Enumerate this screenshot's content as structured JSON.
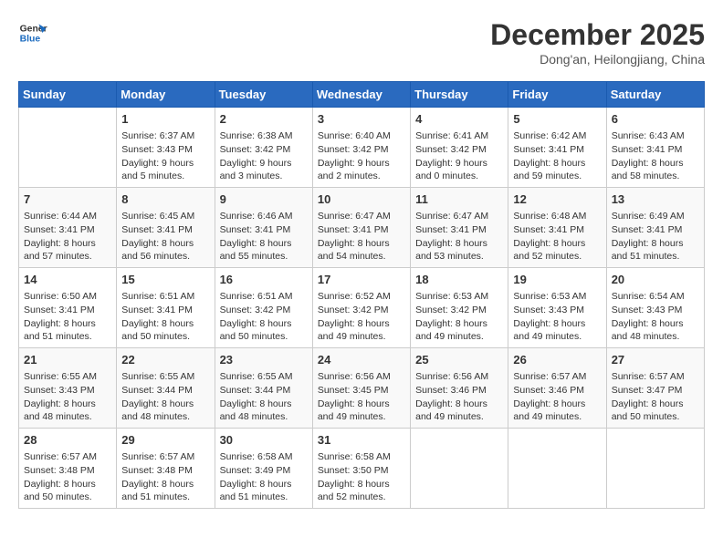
{
  "logo": {
    "line1": "General",
    "line2": "Blue"
  },
  "title": "December 2025",
  "subtitle": "Dong'an, Heilongjiang, China",
  "days_header": [
    "Sunday",
    "Monday",
    "Tuesday",
    "Wednesday",
    "Thursday",
    "Friday",
    "Saturday"
  ],
  "weeks": [
    [
      {
        "num": "",
        "info": ""
      },
      {
        "num": "1",
        "info": "Sunrise: 6:37 AM\nSunset: 3:43 PM\nDaylight: 9 hours\nand 5 minutes."
      },
      {
        "num": "2",
        "info": "Sunrise: 6:38 AM\nSunset: 3:42 PM\nDaylight: 9 hours\nand 3 minutes."
      },
      {
        "num": "3",
        "info": "Sunrise: 6:40 AM\nSunset: 3:42 PM\nDaylight: 9 hours\nand 2 minutes."
      },
      {
        "num": "4",
        "info": "Sunrise: 6:41 AM\nSunset: 3:42 PM\nDaylight: 9 hours\nand 0 minutes."
      },
      {
        "num": "5",
        "info": "Sunrise: 6:42 AM\nSunset: 3:41 PM\nDaylight: 8 hours\nand 59 minutes."
      },
      {
        "num": "6",
        "info": "Sunrise: 6:43 AM\nSunset: 3:41 PM\nDaylight: 8 hours\nand 58 minutes."
      }
    ],
    [
      {
        "num": "7",
        "info": "Sunrise: 6:44 AM\nSunset: 3:41 PM\nDaylight: 8 hours\nand 57 minutes."
      },
      {
        "num": "8",
        "info": "Sunrise: 6:45 AM\nSunset: 3:41 PM\nDaylight: 8 hours\nand 56 minutes."
      },
      {
        "num": "9",
        "info": "Sunrise: 6:46 AM\nSunset: 3:41 PM\nDaylight: 8 hours\nand 55 minutes."
      },
      {
        "num": "10",
        "info": "Sunrise: 6:47 AM\nSunset: 3:41 PM\nDaylight: 8 hours\nand 54 minutes."
      },
      {
        "num": "11",
        "info": "Sunrise: 6:47 AM\nSunset: 3:41 PM\nDaylight: 8 hours\nand 53 minutes."
      },
      {
        "num": "12",
        "info": "Sunrise: 6:48 AM\nSunset: 3:41 PM\nDaylight: 8 hours\nand 52 minutes."
      },
      {
        "num": "13",
        "info": "Sunrise: 6:49 AM\nSunset: 3:41 PM\nDaylight: 8 hours\nand 51 minutes."
      }
    ],
    [
      {
        "num": "14",
        "info": "Sunrise: 6:50 AM\nSunset: 3:41 PM\nDaylight: 8 hours\nand 51 minutes."
      },
      {
        "num": "15",
        "info": "Sunrise: 6:51 AM\nSunset: 3:41 PM\nDaylight: 8 hours\nand 50 minutes."
      },
      {
        "num": "16",
        "info": "Sunrise: 6:51 AM\nSunset: 3:42 PM\nDaylight: 8 hours\nand 50 minutes."
      },
      {
        "num": "17",
        "info": "Sunrise: 6:52 AM\nSunset: 3:42 PM\nDaylight: 8 hours\nand 49 minutes."
      },
      {
        "num": "18",
        "info": "Sunrise: 6:53 AM\nSunset: 3:42 PM\nDaylight: 8 hours\nand 49 minutes."
      },
      {
        "num": "19",
        "info": "Sunrise: 6:53 AM\nSunset: 3:43 PM\nDaylight: 8 hours\nand 49 minutes."
      },
      {
        "num": "20",
        "info": "Sunrise: 6:54 AM\nSunset: 3:43 PM\nDaylight: 8 hours\nand 48 minutes."
      }
    ],
    [
      {
        "num": "21",
        "info": "Sunrise: 6:55 AM\nSunset: 3:43 PM\nDaylight: 8 hours\nand 48 minutes."
      },
      {
        "num": "22",
        "info": "Sunrise: 6:55 AM\nSunset: 3:44 PM\nDaylight: 8 hours\nand 48 minutes."
      },
      {
        "num": "23",
        "info": "Sunrise: 6:55 AM\nSunset: 3:44 PM\nDaylight: 8 hours\nand 48 minutes."
      },
      {
        "num": "24",
        "info": "Sunrise: 6:56 AM\nSunset: 3:45 PM\nDaylight: 8 hours\nand 49 minutes."
      },
      {
        "num": "25",
        "info": "Sunrise: 6:56 AM\nSunset: 3:46 PM\nDaylight: 8 hours\nand 49 minutes."
      },
      {
        "num": "26",
        "info": "Sunrise: 6:57 AM\nSunset: 3:46 PM\nDaylight: 8 hours\nand 49 minutes."
      },
      {
        "num": "27",
        "info": "Sunrise: 6:57 AM\nSunset: 3:47 PM\nDaylight: 8 hours\nand 50 minutes."
      }
    ],
    [
      {
        "num": "28",
        "info": "Sunrise: 6:57 AM\nSunset: 3:48 PM\nDaylight: 8 hours\nand 50 minutes."
      },
      {
        "num": "29",
        "info": "Sunrise: 6:57 AM\nSunset: 3:48 PM\nDaylight: 8 hours\nand 51 minutes."
      },
      {
        "num": "30",
        "info": "Sunrise: 6:58 AM\nSunset: 3:49 PM\nDaylight: 8 hours\nand 51 minutes."
      },
      {
        "num": "31",
        "info": "Sunrise: 6:58 AM\nSunset: 3:50 PM\nDaylight: 8 hours\nand 52 minutes."
      },
      {
        "num": "",
        "info": ""
      },
      {
        "num": "",
        "info": ""
      },
      {
        "num": "",
        "info": ""
      }
    ]
  ]
}
